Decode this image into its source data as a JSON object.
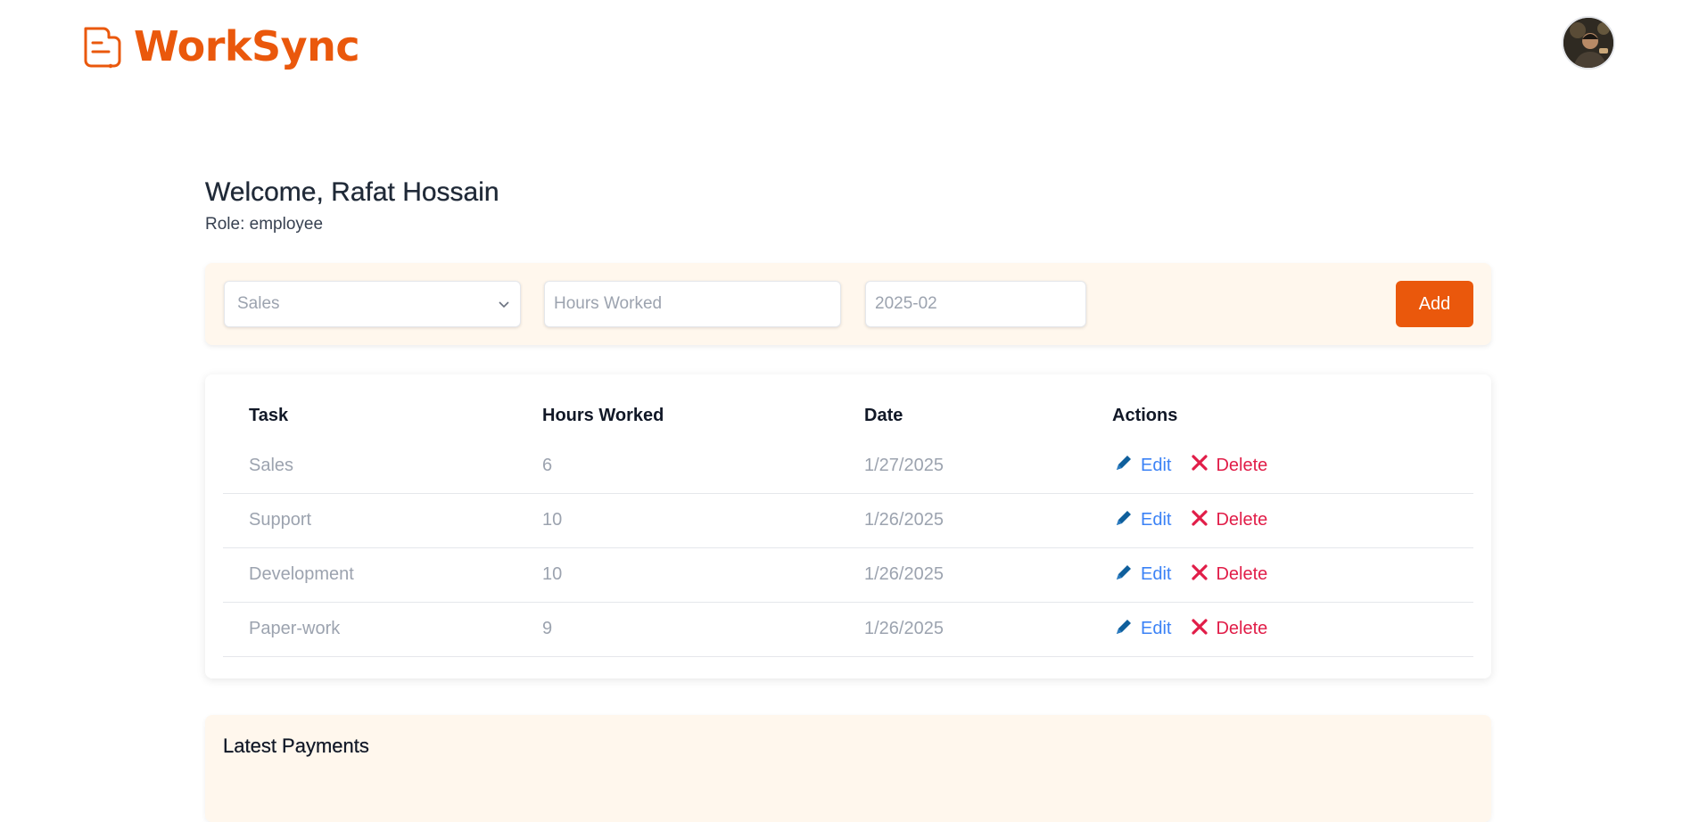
{
  "brand": {
    "name": "WorkSync",
    "color": "#ea580c"
  },
  "user": {
    "welcome": "Welcome, Rafat Hossain",
    "role": "Role: employee"
  },
  "form": {
    "task_selected": "Sales",
    "hours_placeholder": "Hours Worked",
    "date_value": "2025-02",
    "add_label": "Add"
  },
  "table": {
    "headers": [
      "Task",
      "Hours Worked",
      "Date",
      "Actions"
    ],
    "rows": [
      {
        "task": "Sales",
        "hours": "6",
        "date": "1/27/2025"
      },
      {
        "task": "Support",
        "hours": "10",
        "date": "1/26/2025"
      },
      {
        "task": "Development",
        "hours": "10",
        "date": "1/26/2025"
      },
      {
        "task": "Paper-work",
        "hours": "9",
        "date": "1/26/2025"
      }
    ],
    "edit_label": "Edit",
    "delete_label": "Delete"
  },
  "payments": {
    "title": "Latest Payments"
  },
  "colors": {
    "accent": "#ea580c",
    "edit": "#3b82f6",
    "delete": "#e11d48",
    "panel_bg": "#fff7ed"
  }
}
